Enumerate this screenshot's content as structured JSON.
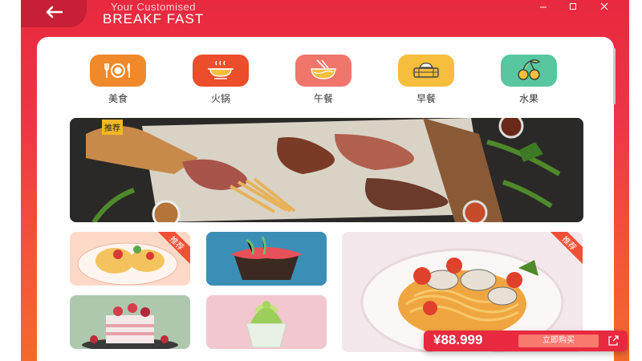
{
  "header": {
    "subtitle": "Your Customised",
    "title": "BREAKF FAST",
    "back_icon": "arrow-left-icon",
    "window_controls": [
      "minimize-icon",
      "maximize-icon",
      "close-icon"
    ]
  },
  "categories": [
    {
      "label": "美食",
      "icon": "plate-cutlery-icon",
      "color": "#f0892c"
    },
    {
      "label": "火锅",
      "icon": "hotpot-icon",
      "color": "#ec4d2a"
    },
    {
      "label": "午餐",
      "icon": "noodle-bowl-icon",
      "color": "#f0766c"
    },
    {
      "label": "早餐",
      "icon": "steamer-basket-icon",
      "color": "#f5be3c"
    },
    {
      "label": "水果",
      "icon": "cherry-icon",
      "color": "#58c7a0"
    }
  ],
  "banner": {
    "badge": "推荐"
  },
  "tiles": [
    {
      "name": "pancake-dessert",
      "badge": "推荐"
    },
    {
      "name": "berry-tart"
    },
    {
      "name": "layer-cake"
    },
    {
      "name": "matcha-sundae"
    }
  ],
  "feature": {
    "badge": "推荐"
  },
  "purchase": {
    "price": "¥88.999",
    "button_label": "立即购买",
    "share_icon": "share-icon"
  },
  "colors": {
    "brand": "#e8293f",
    "accent": "#f46a2a"
  }
}
